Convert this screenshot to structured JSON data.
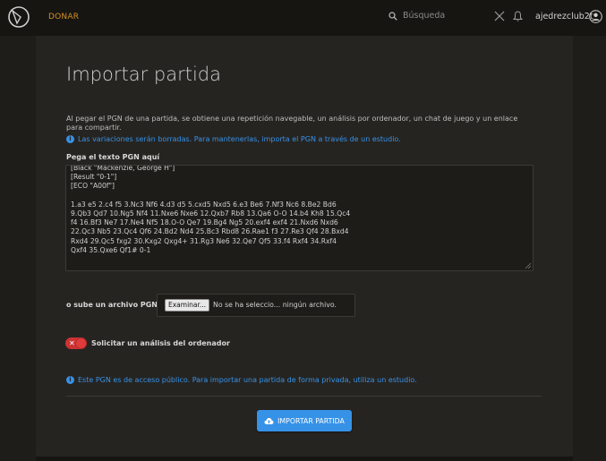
{
  "header": {
    "donate_label": "DONAR",
    "search_placeholder": "Búsqueda",
    "username": "ajedrezclub2t"
  },
  "main": {
    "title": "Importar partida",
    "description": "Al pegar el PGN de una partida, se obtiene una repetición navegable, un análisis por ordenador, un chat de juego y un enlace para compartir.",
    "variations_note": "Las variaciones serán borradas. Para mantenerlas, importa el PGN a través de un estudio.",
    "pgn_label": "Pega el texto PGN aquí",
    "pgn_value": "[Black \"Mackenzie, George H\"]\n[Result \"0-1\"]\n[ECO \"A00f\"]\n\n1.a3 e5 2.c4 f5 3.Nc3 Nf6 4.d3 d5 5.cxd5 Nxd5 6.e3 Be6 7.Nf3 Nc6 8.Be2 Bd6\n9.Qb3 Qd7 10.Ng5 Nf4 11.Nxe6 Nxe6 12.Qxb7 Rb8 13.Qa6 O-O 14.b4 Kh8 15.Qc4\nf4 16.Bf3 Ne7 17.Ne4 Nf5 18.O-O Qe7 19.Bg4 Ng5 20.exf4 exf4 21.Nxd6 Nxd6\n22.Qc3 Nb5 23.Qc4 Qf6 24.Bd2 Nd4 25.Bc3 Rbd8 26.Rae1 f3 27.Re3 Qf4 28.Bxd4\nRxd4 29.Qc5 fxg2 30.Kxg2 Qxg4+ 31.Rg3 Ne6 32.Qe7 Qf5 33.f4 Rxf4 34.Rxf4\nQxf4 35.Qxe6 Qf1# 0-1",
    "upload_label": "o sube un archivo PGN",
    "file_button_label": "Examinar...",
    "file_status": "No se ha seleccio... ningún archivo.",
    "analysis_label": "Solicitar un análisis del ordenador",
    "analysis_enabled": false,
    "public_note": "Este PGN es de acceso público. Para importar una partida de forma privada, utiliza un estudio.",
    "import_button_label": "IMPORTAR PARTIDA"
  },
  "colors": {
    "accent": "#3692e7",
    "donate": "#d59020",
    "toggle_off": "#cc3333"
  }
}
